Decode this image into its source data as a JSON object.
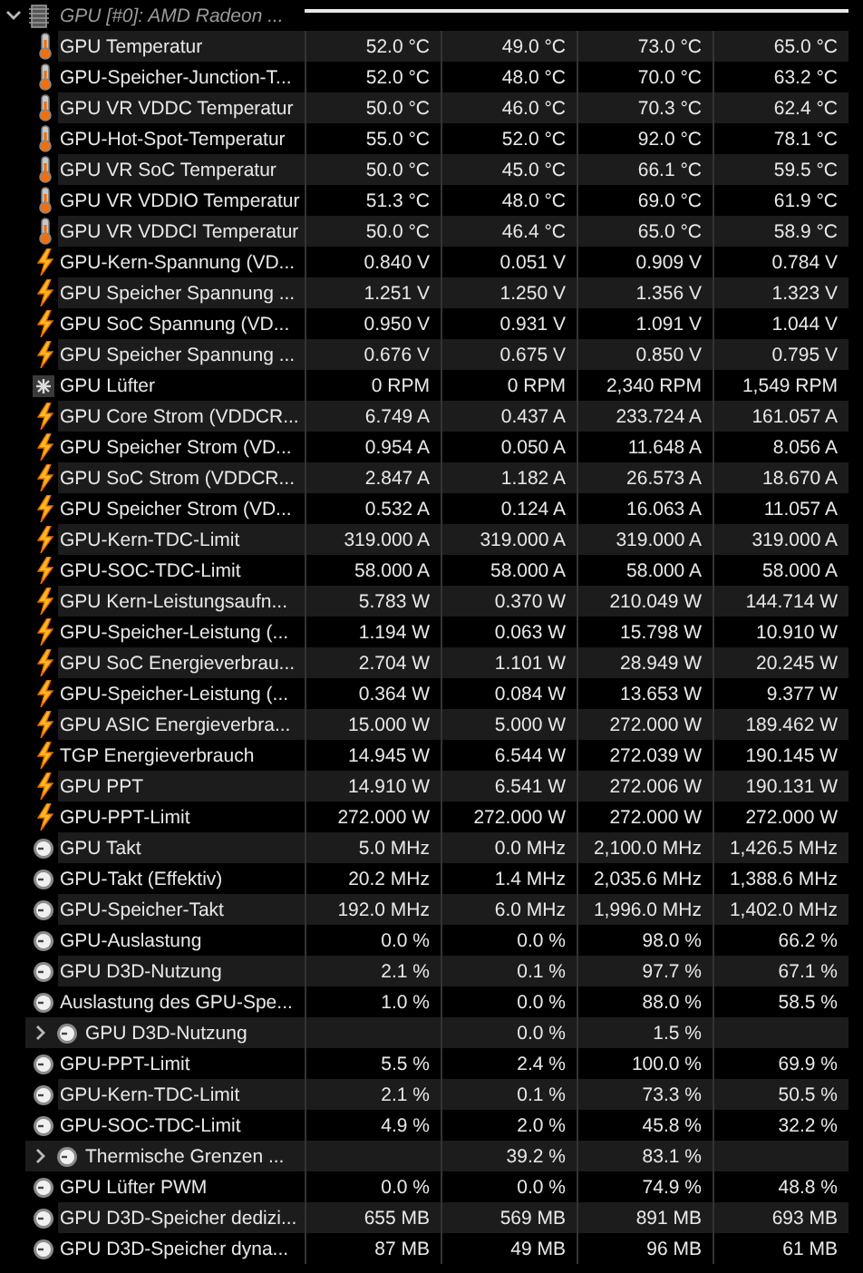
{
  "device": {
    "name": "GPU [#0]: AMD Radeon ...",
    "expanded": true
  },
  "sensors": [
    {
      "kind": "temperature",
      "name": "GPU Temperatur",
      "values": [
        "52.0 °C",
        "49.0 °C",
        "73.0 °C",
        "65.0 °C"
      ]
    },
    {
      "kind": "temperature",
      "name": "GPU-Speicher-Junction-T...",
      "values": [
        "52.0 °C",
        "48.0 °C",
        "70.0 °C",
        "63.2 °C"
      ]
    },
    {
      "kind": "temperature",
      "name": "GPU VR VDDC Temperatur",
      "values": [
        "50.0 °C",
        "46.0 °C",
        "70.3 °C",
        "62.4 °C"
      ]
    },
    {
      "kind": "temperature",
      "name": "GPU-Hot-Spot-Temperatur",
      "values": [
        "55.0 °C",
        "52.0 °C",
        "92.0 °C",
        "78.1 °C"
      ]
    },
    {
      "kind": "temperature",
      "name": "GPU VR SoC Temperatur",
      "values": [
        "50.0 °C",
        "45.0 °C",
        "66.1 °C",
        "59.5 °C"
      ]
    },
    {
      "kind": "temperature",
      "name": "GPU VR VDDIO Temperatur",
      "values": [
        "51.3 °C",
        "48.0 °C",
        "69.0 °C",
        "61.9 °C"
      ]
    },
    {
      "kind": "temperature",
      "name": "GPU VR VDDCI Temperatur",
      "values": [
        "50.0 °C",
        "46.4 °C",
        "65.0 °C",
        "58.9 °C"
      ]
    },
    {
      "kind": "electric",
      "name": "GPU-Kern-Spannung (VD...",
      "values": [
        "0.840 V",
        "0.051 V",
        "0.909 V",
        "0.784 V"
      ]
    },
    {
      "kind": "electric",
      "name": "GPU Speicher Spannung ...",
      "values": [
        "1.251 V",
        "1.250 V",
        "1.356 V",
        "1.323 V"
      ]
    },
    {
      "kind": "electric",
      "name": "GPU SoC Spannung (VD...",
      "values": [
        "0.950 V",
        "0.931 V",
        "1.091 V",
        "1.044 V"
      ]
    },
    {
      "kind": "electric",
      "name": "GPU Speicher Spannung ...",
      "values": [
        "0.676 V",
        "0.675 V",
        "0.850 V",
        "0.795 V"
      ]
    },
    {
      "kind": "fan",
      "name": "GPU Lüfter",
      "values": [
        "0 RPM",
        "0 RPM",
        "2,340 RPM",
        "1,549 RPM"
      ]
    },
    {
      "kind": "electric",
      "name": "GPU Core Strom (VDDCR...",
      "values": [
        "6.749 A",
        "0.437 A",
        "233.724 A",
        "161.057 A"
      ]
    },
    {
      "kind": "electric",
      "name": "GPU Speicher Strom (VD...",
      "values": [
        "0.954 A",
        "0.050 A",
        "11.648 A",
        "8.056 A"
      ]
    },
    {
      "kind": "electric",
      "name": "GPU SoC Strom (VDDCR...",
      "values": [
        "2.847 A",
        "1.182 A",
        "26.573 A",
        "18.670 A"
      ]
    },
    {
      "kind": "electric",
      "name": "GPU Speicher Strom (VD...",
      "values": [
        "0.532 A",
        "0.124 A",
        "16.063 A",
        "11.057 A"
      ]
    },
    {
      "kind": "electric",
      "name": "GPU-Kern-TDC-Limit",
      "values": [
        "319.000 A",
        "319.000 A",
        "319.000 A",
        "319.000 A"
      ]
    },
    {
      "kind": "electric",
      "name": "GPU-SOC-TDC-Limit",
      "values": [
        "58.000 A",
        "58.000 A",
        "58.000 A",
        "58.000 A"
      ]
    },
    {
      "kind": "electric",
      "name": "GPU Kern-Leistungsaufn...",
      "values": [
        "5.783 W",
        "0.370 W",
        "210.049 W",
        "144.714 W"
      ]
    },
    {
      "kind": "electric",
      "name": "GPU-Speicher-Leistung (...",
      "values": [
        "1.194 W",
        "0.063 W",
        "15.798 W",
        "10.910 W"
      ]
    },
    {
      "kind": "electric",
      "name": "GPU SoC Energieverbrau...",
      "values": [
        "2.704 W",
        "1.101 W",
        "28.949 W",
        "20.245 W"
      ]
    },
    {
      "kind": "electric",
      "name": "GPU-Speicher-Leistung (...",
      "values": [
        "0.364 W",
        "0.084 W",
        "13.653 W",
        "9.377 W"
      ]
    },
    {
      "kind": "electric",
      "name": "GPU ASIC Energieverbra...",
      "values": [
        "15.000 W",
        "5.000 W",
        "272.000 W",
        "189.462 W"
      ]
    },
    {
      "kind": "electric",
      "name": "TGP Energieverbrauch",
      "values": [
        "14.945 W",
        "6.544 W",
        "272.039 W",
        "190.145 W"
      ]
    },
    {
      "kind": "electric",
      "name": "GPU PPT",
      "values": [
        "14.910 W",
        "6.541 W",
        "272.006 W",
        "190.131 W"
      ]
    },
    {
      "kind": "electric",
      "name": "GPU-PPT-Limit",
      "values": [
        "272.000 W",
        "272.000 W",
        "272.000 W",
        "272.000 W"
      ]
    },
    {
      "kind": "gauge",
      "name": "GPU Takt",
      "values": [
        "5.0 MHz",
        "0.0 MHz",
        "2,100.0 MHz",
        "1,426.5 MHz"
      ]
    },
    {
      "kind": "gauge",
      "name": "GPU-Takt (Effektiv)",
      "values": [
        "20.2 MHz",
        "1.4 MHz",
        "2,035.6 MHz",
        "1,388.6 MHz"
      ]
    },
    {
      "kind": "gauge",
      "name": "GPU-Speicher-Takt",
      "values": [
        "192.0 MHz",
        "6.0 MHz",
        "1,996.0 MHz",
        "1,402.0 MHz"
      ]
    },
    {
      "kind": "gauge",
      "name": "GPU-Auslastung",
      "values": [
        "0.0 %",
        "0.0 %",
        "98.0 %",
        "66.2 %"
      ]
    },
    {
      "kind": "gauge",
      "name": "GPU D3D-Nutzung",
      "values": [
        "2.1 %",
        "0.1 %",
        "97.7 %",
        "67.1 %"
      ]
    },
    {
      "kind": "gauge",
      "name": "Auslastung des GPU-Spe...",
      "values": [
        "1.0 %",
        "0.0 %",
        "88.0 %",
        "58.5 %"
      ]
    },
    {
      "kind": "gauge",
      "name": "GPU D3D-Nutzung",
      "expanded": false,
      "values": {
        "column_2": "0.0 %",
        "column_3": "1.5 %"
      }
    },
    {
      "kind": "gauge",
      "name": "GPU-PPT-Limit",
      "values": [
        "5.5 %",
        "2.4 %",
        "100.0 %",
        "69.9 %"
      ]
    },
    {
      "kind": "gauge",
      "name": "GPU-Kern-TDC-Limit",
      "values": [
        "2.1 %",
        "0.1 %",
        "73.3 %",
        "50.5 %"
      ]
    },
    {
      "kind": "gauge",
      "name": "GPU-SOC-TDC-Limit",
      "values": [
        "4.9 %",
        "2.0 %",
        "45.8 %",
        "32.2 %"
      ]
    },
    {
      "kind": "gauge",
      "name": "Thermische Grenzen ...",
      "expanded": false,
      "values": {
        "column_2": "39.2 %",
        "column_3": "83.1 %"
      }
    },
    {
      "kind": "gauge",
      "name": "GPU Lüfter PWM",
      "values": [
        "0.0 %",
        "0.0 %",
        "74.9 %",
        "48.8 %"
      ]
    },
    {
      "kind": "gauge",
      "name": "GPU D3D-Speicher dedizi...",
      "values": [
        "655 MB",
        "569 MB",
        "891 MB",
        "693 MB"
      ]
    },
    {
      "kind": "gauge",
      "name": "GPU D3D-Speicher dyna...",
      "values": [
        "87 MB",
        "49 MB",
        "96 MB",
        "61 MB"
      ]
    }
  ]
}
